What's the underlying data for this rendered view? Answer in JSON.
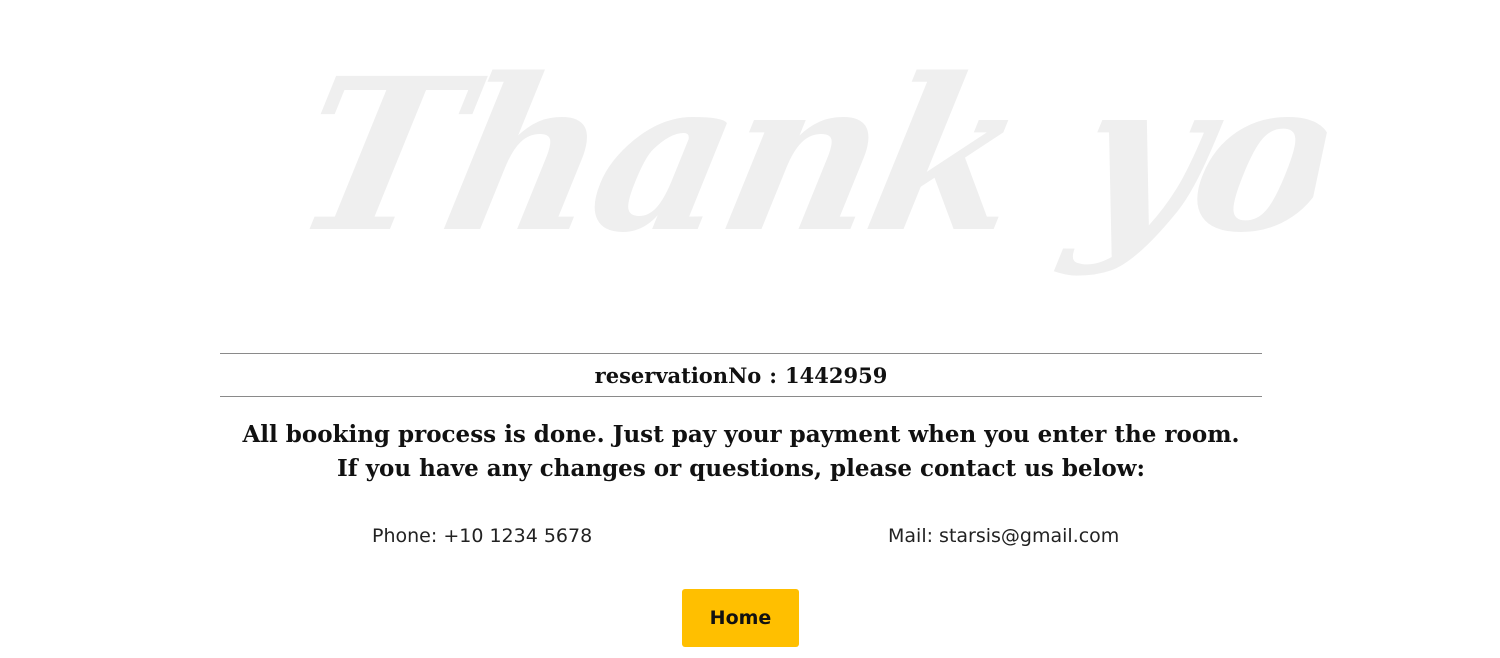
{
  "hero": {
    "title": "Thank you"
  },
  "reservation": {
    "label": "reservationNo",
    "separator": ":",
    "number": "1442959"
  },
  "message": {
    "line1": "All booking process is done. Just pay your payment when you enter the room.",
    "line2": "If you have any changes or questions, please contact us below:"
  },
  "contact": {
    "phone_label": "Phone:",
    "phone_value": "+10 1234 5678",
    "mail_label": "Mail:",
    "mail_value": "starsis@gmail.com"
  },
  "actions": {
    "home_label": "Home"
  },
  "colors": {
    "accent": "#ffbf00",
    "hero_text": "#efefef",
    "rule": "#8a8a8a"
  }
}
